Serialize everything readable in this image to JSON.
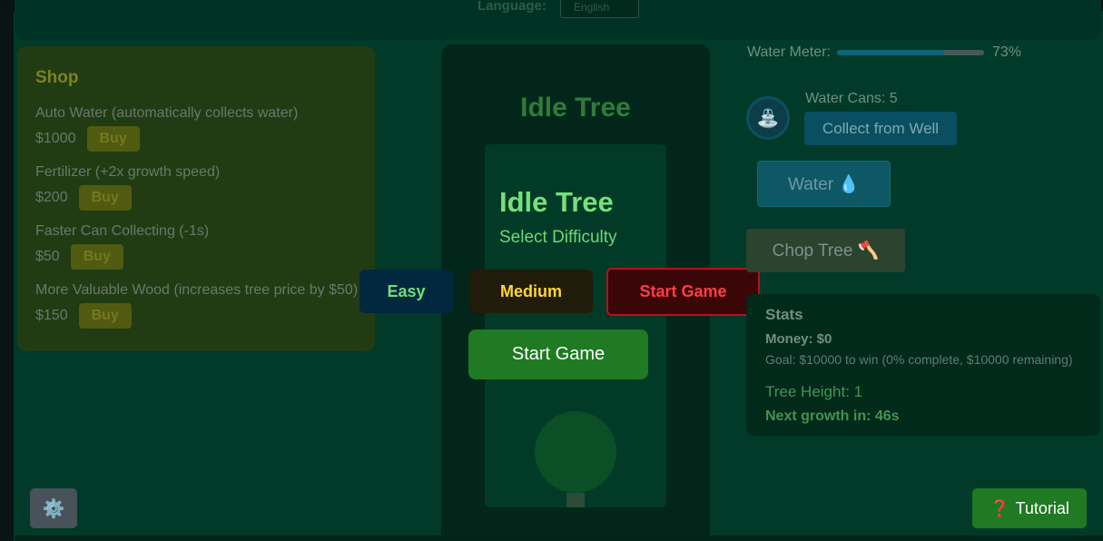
{
  "header": {
    "language_label": "Language:",
    "language_value": "English"
  },
  "shop": {
    "title": "Shop",
    "items": [
      {
        "name": "Auto Water (automatically collects water)",
        "price": "$1000",
        "buy_label": "Buy"
      },
      {
        "name": "Fertilizer (+2x growth speed)",
        "price": "$200",
        "buy_label": "Buy"
      },
      {
        "name": "Faster Can Collecting (-1s)",
        "price": "$50",
        "buy_label": "Buy"
      },
      {
        "name": "More Valuable Wood (increases tree price by $50)",
        "price": "$150",
        "buy_label": "Buy"
      }
    ]
  },
  "game": {
    "title": "Idle Tree"
  },
  "modal": {
    "title": "Idle Tree",
    "subtitle": "Select Difficulty",
    "difficulties": {
      "easy": "Easy",
      "medium": "Medium",
      "hard": "Start Game"
    },
    "start_label": "Start Game"
  },
  "water": {
    "meter_label": "Water Meter:",
    "level_percent": 73,
    "percent_text": "73%",
    "cans_label": "Water Cans: 5",
    "collect_label": "Collect from Well",
    "water_label": "Water 💧",
    "chop_label": "Chop Tree 🪓"
  },
  "stats": {
    "title": "Stats",
    "money": "Money: $0",
    "goal": "Goal: $10000 to win (0% complete, $10000 remaining)",
    "tree_height": "Tree Height: 1",
    "next_growth": "Next growth in: 46s"
  },
  "footer": {
    "settings_icon": "⚙️",
    "tutorial_icon": "❓",
    "tutorial_label": "Tutorial"
  },
  "colors": {
    "background": "#013a29",
    "start_button": "#1f7a23",
    "hard_border": "#b1131c"
  }
}
